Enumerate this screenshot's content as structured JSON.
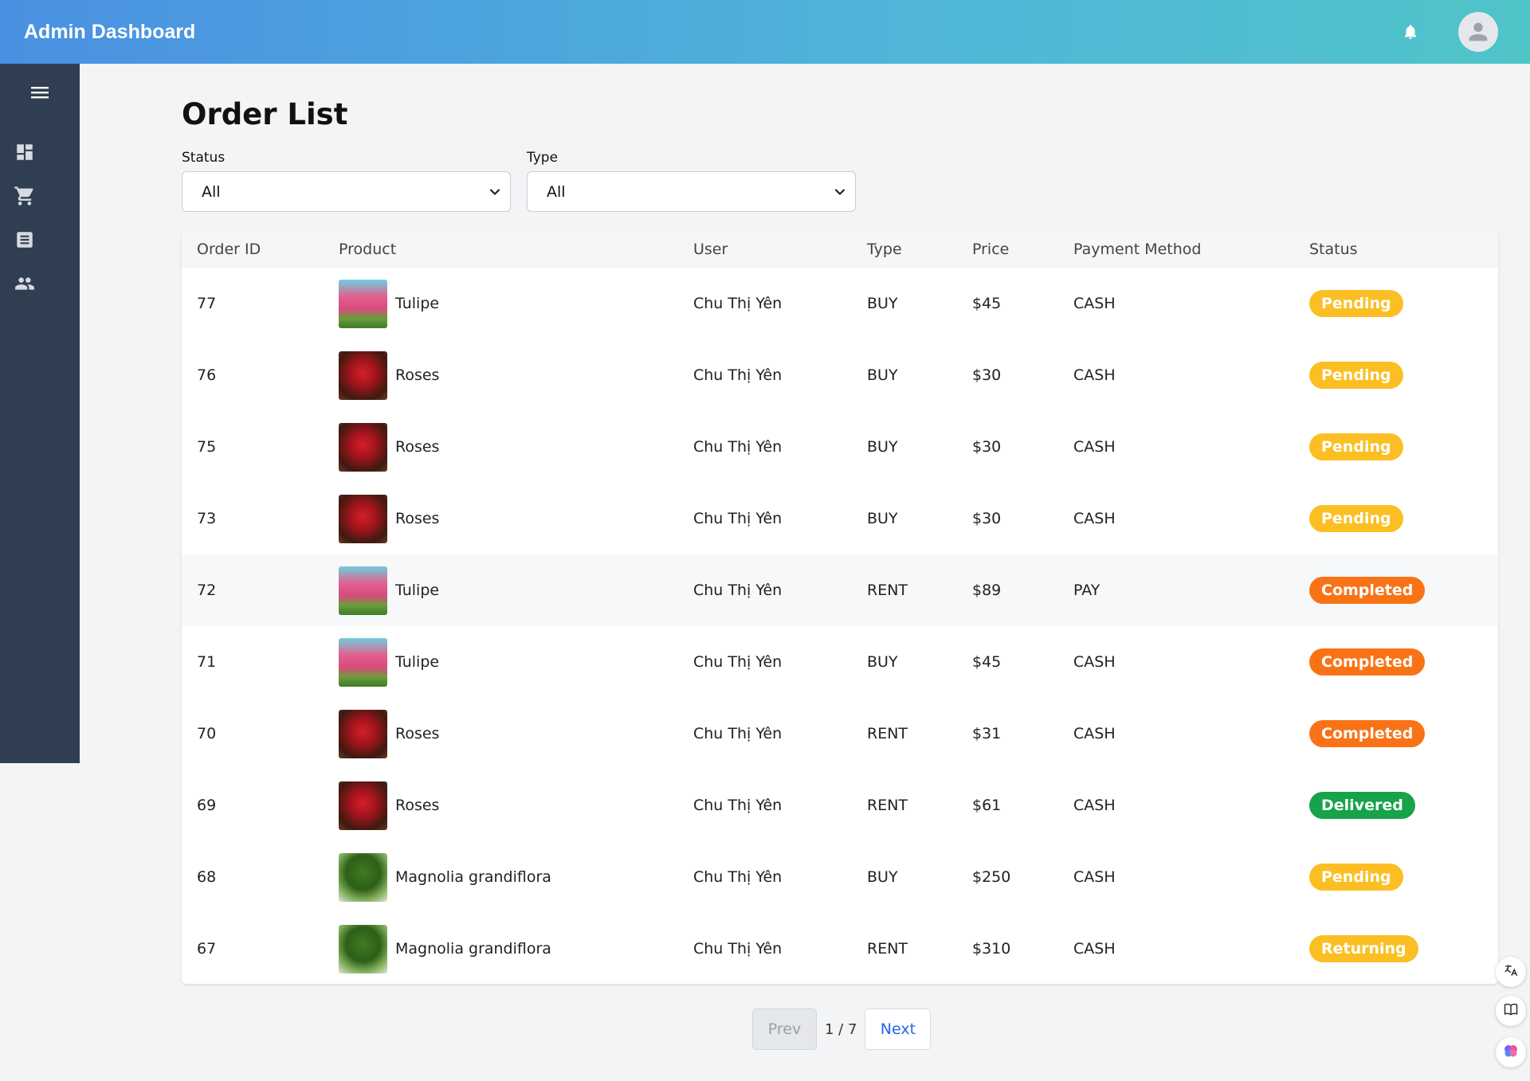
{
  "header": {
    "title": "Admin Dashboard"
  },
  "page": {
    "title": "Order List"
  },
  "filters": {
    "status": {
      "label": "Status",
      "value": "All"
    },
    "type": {
      "label": "Type",
      "value": "All"
    }
  },
  "table": {
    "columns": [
      "Order ID",
      "Product",
      "User",
      "Type",
      "Price",
      "Payment Method",
      "Status"
    ],
    "rows": [
      {
        "id": "77",
        "product": "Tulipe",
        "thumb": "tulip",
        "user": "Chu Thị Yên",
        "type": "BUY",
        "price": "$45",
        "payment": "CASH",
        "status": "Pending"
      },
      {
        "id": "76",
        "product": "Roses",
        "thumb": "rose",
        "user": "Chu Thị Yên",
        "type": "BUY",
        "price": "$30",
        "payment": "CASH",
        "status": "Pending"
      },
      {
        "id": "75",
        "product": "Roses",
        "thumb": "rose",
        "user": "Chu Thị Yên",
        "type": "BUY",
        "price": "$30",
        "payment": "CASH",
        "status": "Pending"
      },
      {
        "id": "73",
        "product": "Roses",
        "thumb": "rose",
        "user": "Chu Thị Yên",
        "type": "BUY",
        "price": "$30",
        "payment": "CASH",
        "status": "Pending"
      },
      {
        "id": "72",
        "product": "Tulipe",
        "thumb": "tulip",
        "user": "Chu Thị Yên",
        "type": "RENT",
        "price": "$89",
        "payment": "PAY",
        "status": "Completed"
      },
      {
        "id": "71",
        "product": "Tulipe",
        "thumb": "tulip",
        "user": "Chu Thị Yên",
        "type": "BUY",
        "price": "$45",
        "payment": "CASH",
        "status": "Completed"
      },
      {
        "id": "70",
        "product": "Roses",
        "thumb": "rose",
        "user": "Chu Thị Yên",
        "type": "RENT",
        "price": "$31",
        "payment": "CASH",
        "status": "Completed"
      },
      {
        "id": "69",
        "product": "Roses",
        "thumb": "rose",
        "user": "Chu Thị Yên",
        "type": "RENT",
        "price": "$61",
        "payment": "CASH",
        "status": "Delivered"
      },
      {
        "id": "68",
        "product": "Magnolia grandiflora",
        "thumb": "magnolia",
        "user": "Chu Thị Yên",
        "type": "BUY",
        "price": "$250",
        "payment": "CASH",
        "status": "Pending"
      },
      {
        "id": "67",
        "product": "Magnolia grandiflora",
        "thumb": "magnolia",
        "user": "Chu Thị Yên",
        "type": "RENT",
        "price": "$310",
        "payment": "CASH",
        "status": "Returning"
      }
    ]
  },
  "status_colors": {
    "Pending": "#fbbf24",
    "Completed": "#f97316",
    "Delivered": "#16a34a",
    "Returning": "#fbbf24"
  },
  "pagination": {
    "prev_label": "Prev",
    "page_info": "1 / 7",
    "next_label": "Next"
  },
  "sidebar": {
    "items": [
      {
        "icon": "menu-icon"
      },
      {
        "icon": "dashboard-icon"
      },
      {
        "icon": "cart-icon"
      },
      {
        "icon": "receipt-icon"
      },
      {
        "icon": "users-icon"
      }
    ]
  },
  "floating_tools": [
    "translate-icon",
    "book-icon",
    "brain-icon"
  ]
}
